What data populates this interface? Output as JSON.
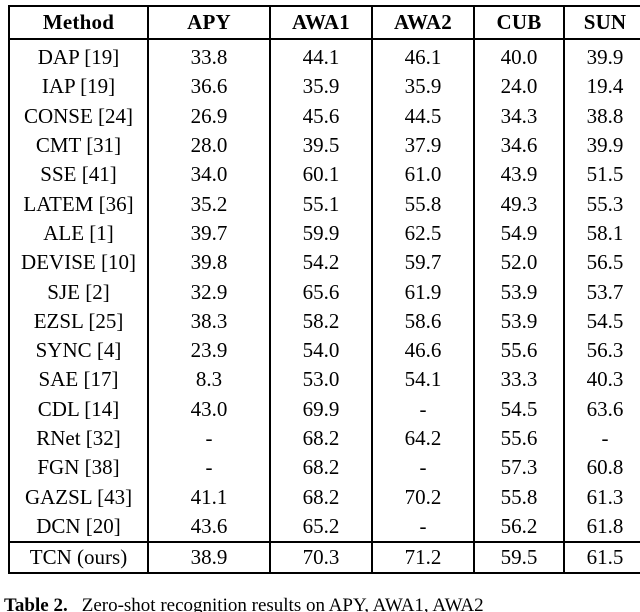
{
  "table": {
    "name": "zero-shot-recognition-results-table",
    "columns": [
      "Method",
      "APY",
      "AWA1",
      "AWA2",
      "CUB",
      "SUN"
    ],
    "rows": [
      {
        "method": "DAP [19]",
        "values": [
          "33.8",
          "44.1",
          "46.1",
          "40.0",
          "39.9"
        ],
        "bold": [
          false,
          false,
          false,
          false,
          false
        ]
      },
      {
        "method": "IAP [19]",
        "values": [
          "36.6",
          "35.9",
          "35.9",
          "24.0",
          "19.4"
        ],
        "bold": [
          false,
          false,
          false,
          false,
          false
        ]
      },
      {
        "method": "CONSE [24]",
        "values": [
          "26.9",
          "45.6",
          "44.5",
          "34.3",
          "38.8"
        ],
        "bold": [
          false,
          false,
          false,
          false,
          false
        ]
      },
      {
        "method": "CMT [31]",
        "values": [
          "28.0",
          "39.5",
          "37.9",
          "34.6",
          "39.9"
        ],
        "bold": [
          false,
          false,
          false,
          false,
          false
        ]
      },
      {
        "method": "SSE [41]",
        "values": [
          "34.0",
          "60.1",
          "61.0",
          "43.9",
          "51.5"
        ],
        "bold": [
          false,
          false,
          false,
          false,
          false
        ]
      },
      {
        "method": "LATEM [36]",
        "values": [
          "35.2",
          "55.1",
          "55.8",
          "49.3",
          "55.3"
        ],
        "bold": [
          false,
          false,
          false,
          false,
          false
        ]
      },
      {
        "method": "ALE [1]",
        "values": [
          "39.7",
          "59.9",
          "62.5",
          "54.9",
          "58.1"
        ],
        "bold": [
          false,
          false,
          false,
          false,
          false
        ]
      },
      {
        "method": "DEVISE [10]",
        "values": [
          "39.8",
          "54.2",
          "59.7",
          "52.0",
          "56.5"
        ],
        "bold": [
          false,
          false,
          false,
          false,
          false
        ]
      },
      {
        "method": "SJE [2]",
        "values": [
          "32.9",
          "65.6",
          "61.9",
          "53.9",
          "53.7"
        ],
        "bold": [
          false,
          false,
          false,
          false,
          false
        ]
      },
      {
        "method": "EZSL [25]",
        "values": [
          "38.3",
          "58.2",
          "58.6",
          "53.9",
          "54.5"
        ],
        "bold": [
          false,
          false,
          false,
          false,
          false
        ]
      },
      {
        "method": "SYNC [4]",
        "values": [
          "23.9",
          "54.0",
          "46.6",
          "55.6",
          "56.3"
        ],
        "bold": [
          false,
          false,
          false,
          false,
          false
        ]
      },
      {
        "method": "SAE [17]",
        "values": [
          "8.3",
          "53.0",
          "54.1",
          "33.3",
          "40.3"
        ],
        "bold": [
          false,
          false,
          false,
          false,
          false
        ]
      },
      {
        "method": "CDL [14]",
        "values": [
          "43.0",
          "69.9",
          "-",
          "54.5",
          "63.6"
        ],
        "bold": [
          false,
          false,
          false,
          false,
          true
        ]
      },
      {
        "method": "RNet [32]",
        "values": [
          "-",
          "68.2",
          "64.2",
          "55.6",
          "-"
        ],
        "bold": [
          false,
          false,
          false,
          false,
          false
        ]
      },
      {
        "method": "FGN [38]",
        "values": [
          "-",
          "68.2",
          "-",
          "57.3",
          "60.8"
        ],
        "bold": [
          false,
          false,
          false,
          false,
          false
        ]
      },
      {
        "method": "GAZSL [43]",
        "values": [
          "41.1",
          "68.2",
          "70.2",
          "55.8",
          "61.3"
        ],
        "bold": [
          false,
          false,
          false,
          false,
          false
        ]
      },
      {
        "method": "DCN [20]",
        "values": [
          "43.6",
          "65.2",
          "-",
          "56.2",
          "61.8"
        ],
        "bold": [
          true,
          false,
          false,
          false,
          false
        ]
      }
    ],
    "ours_row": {
      "method": "TCN (ours)",
      "values": [
        "38.9",
        "70.3",
        "71.2",
        "59.5",
        "61.5"
      ],
      "bold": [
        false,
        true,
        true,
        true,
        false
      ]
    }
  },
  "caption": {
    "label": "Table 2.",
    "text": "Zero-shot recognition results on APY, AWA1, AWA2"
  }
}
